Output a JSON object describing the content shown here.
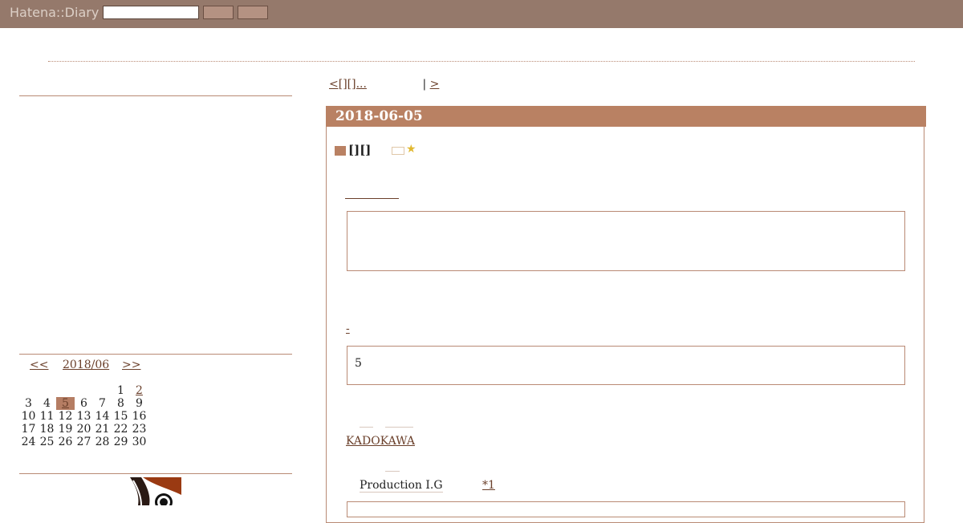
{
  "header": {
    "logo": "Hatena::Diary",
    "search_value": "",
    "button1_label": "",
    "button2_label": ""
  },
  "pager": {
    "prev": "<[][]...",
    "separator": "|",
    "next": ">"
  },
  "entry": {
    "date": "2018-06-05",
    "section_title": "[][]",
    "block1_text": "",
    "block2_text": "5",
    "link_dash": "-",
    "kadokawa": "KADOKAWA",
    "production": "Production I.G",
    "footnote": "*1"
  },
  "calendar": {
    "prev": "<<",
    "month": "2018/06",
    "next": ">>",
    "weeks": [
      [
        "",
        "",
        "",
        "",
        "",
        "1",
        "2"
      ],
      [
        "3",
        "4",
        "5",
        "6",
        "7",
        "8",
        "9"
      ],
      [
        "10",
        "11",
        "12",
        "13",
        "14",
        "15",
        "16"
      ],
      [
        "17",
        "18",
        "19",
        "20",
        "21",
        "22",
        "23"
      ],
      [
        "24",
        "25",
        "26",
        "27",
        "28",
        "29",
        "30"
      ]
    ],
    "today": "5",
    "linked": [
      "2",
      "5"
    ]
  },
  "colors": {
    "topbar": "#95796b",
    "accent": "#b98163",
    "link": "#6a3f2a",
    "star": "#e1b830"
  },
  "icons": {
    "bookmark": "hatena-bookmark-icon",
    "star": "star-icon"
  }
}
